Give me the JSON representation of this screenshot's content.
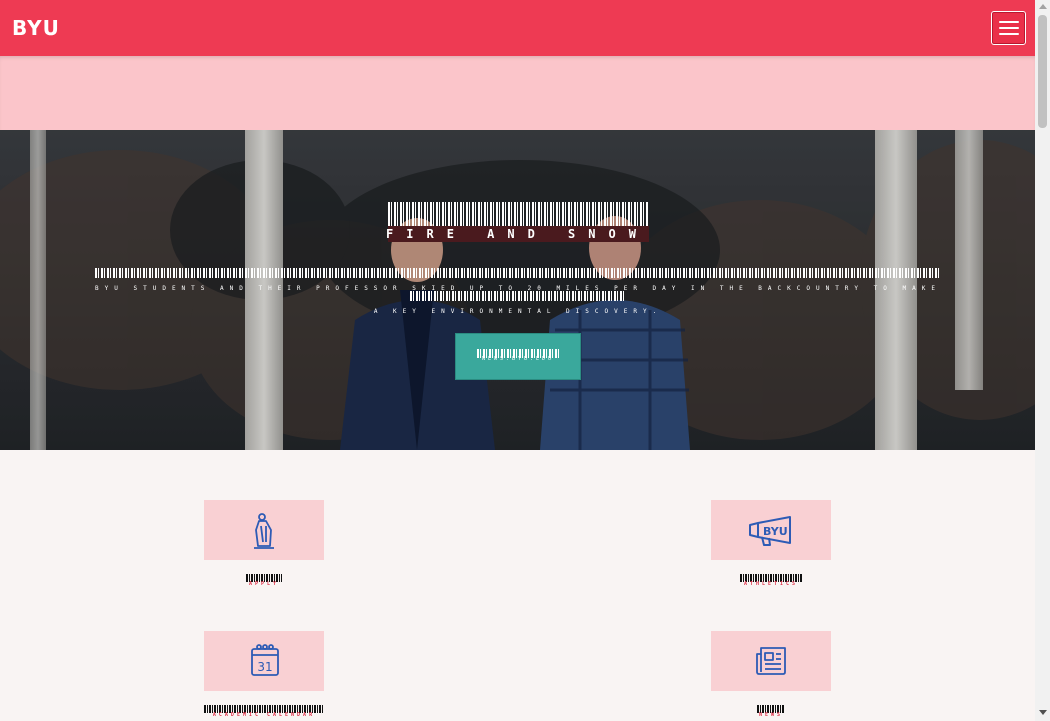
{
  "header": {
    "logo_text": "BYU",
    "menu_icon": "hamburger-menu-icon",
    "brand_color": "#ee3a53"
  },
  "hero": {
    "title": "FIRE AND SNOW",
    "subtitle": "BYU STUDENTS AND THEIR PROFESSOR SKIED UP TO 20 MILES PER DAY IN THE BACKCOUNTRY TO MAKE A KEY ENVIRONMENTAL DISCOVERY.",
    "cta_label": "NEWS.BYU.EDU",
    "cta_color": "#3aa89c"
  },
  "quick_links": [
    {
      "label": "APPLY",
      "icon": "graduate-statue-icon"
    },
    {
      "label": "ATHLETICS",
      "icon": "byu-megaphone-icon"
    },
    {
      "label": "ACADEMIC CALENDAR",
      "icon": "calendar-icon"
    },
    {
      "label": "NEWS",
      "icon": "newspaper-icon"
    }
  ],
  "calendar_icon_day": "31"
}
